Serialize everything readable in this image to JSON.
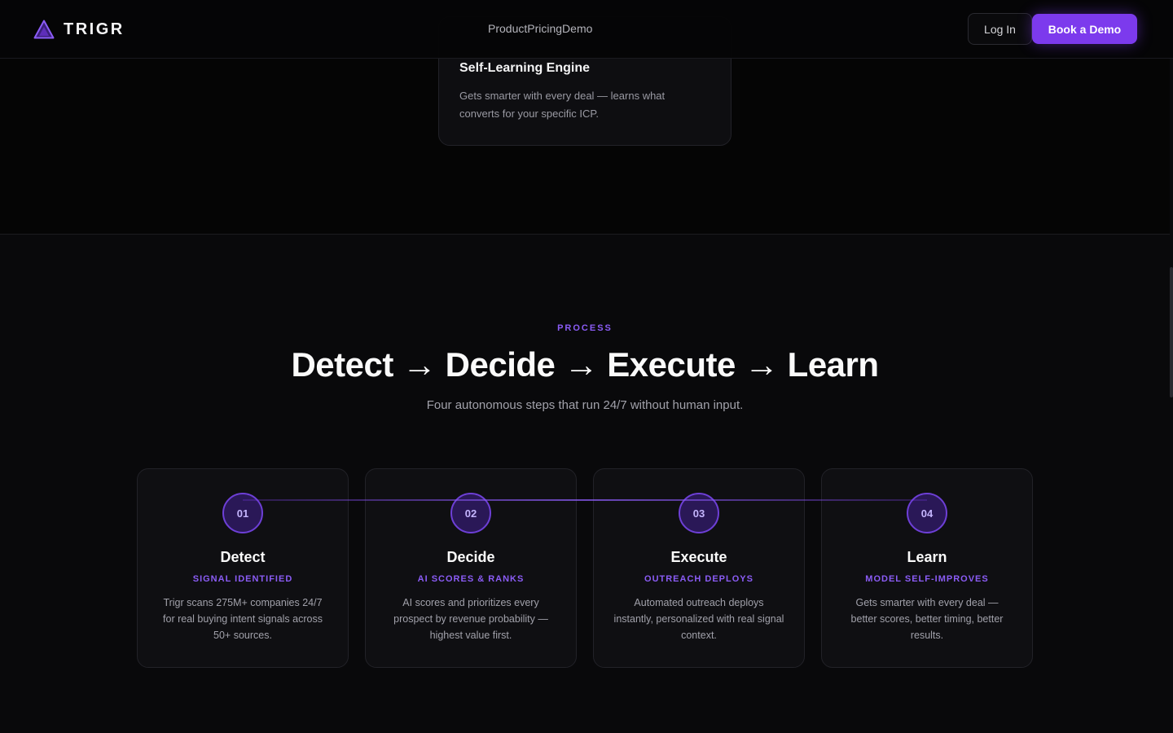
{
  "nav": {
    "brand": "TRIGR",
    "links": [
      "Product",
      "Pricing",
      "Demo"
    ],
    "login": "Log In",
    "cta": "Book a Demo"
  },
  "feature": {
    "title": "Self-Learning Engine",
    "desc": "Gets smarter with every deal — learns what converts for your specific ICP."
  },
  "process": {
    "label": "PROCESS",
    "title": "Detect → Decide → Execute → Learn",
    "subtitle": "Four autonomous steps that run 24/7 without human input.",
    "steps": [
      {
        "num": "01",
        "title": "Detect",
        "tag": "SIGNAL IDENTIFIED",
        "desc": "Trigr scans 275M+ companies 24/7 for real buying intent signals across 50+ sources."
      },
      {
        "num": "02",
        "title": "Decide",
        "tag": "AI SCORES & RANKS",
        "desc": "AI scores and prioritizes every prospect by revenue probability — highest value first."
      },
      {
        "num": "03",
        "title": "Execute",
        "tag": "OUTREACH DEPLOYS",
        "desc": "Automated outreach deploys instantly, personalized with real signal context."
      },
      {
        "num": "04",
        "title": "Learn",
        "tag": "MODEL SELF-IMPROVES",
        "desc": "Gets smarter with every deal — better scores, better timing, better results."
      }
    ]
  },
  "colors": {
    "accent": "#7c3aed",
    "accent_light": "#8b5cf6",
    "background": "#09090b"
  },
  "icons": {
    "logo": "triangle-logo-icon"
  }
}
